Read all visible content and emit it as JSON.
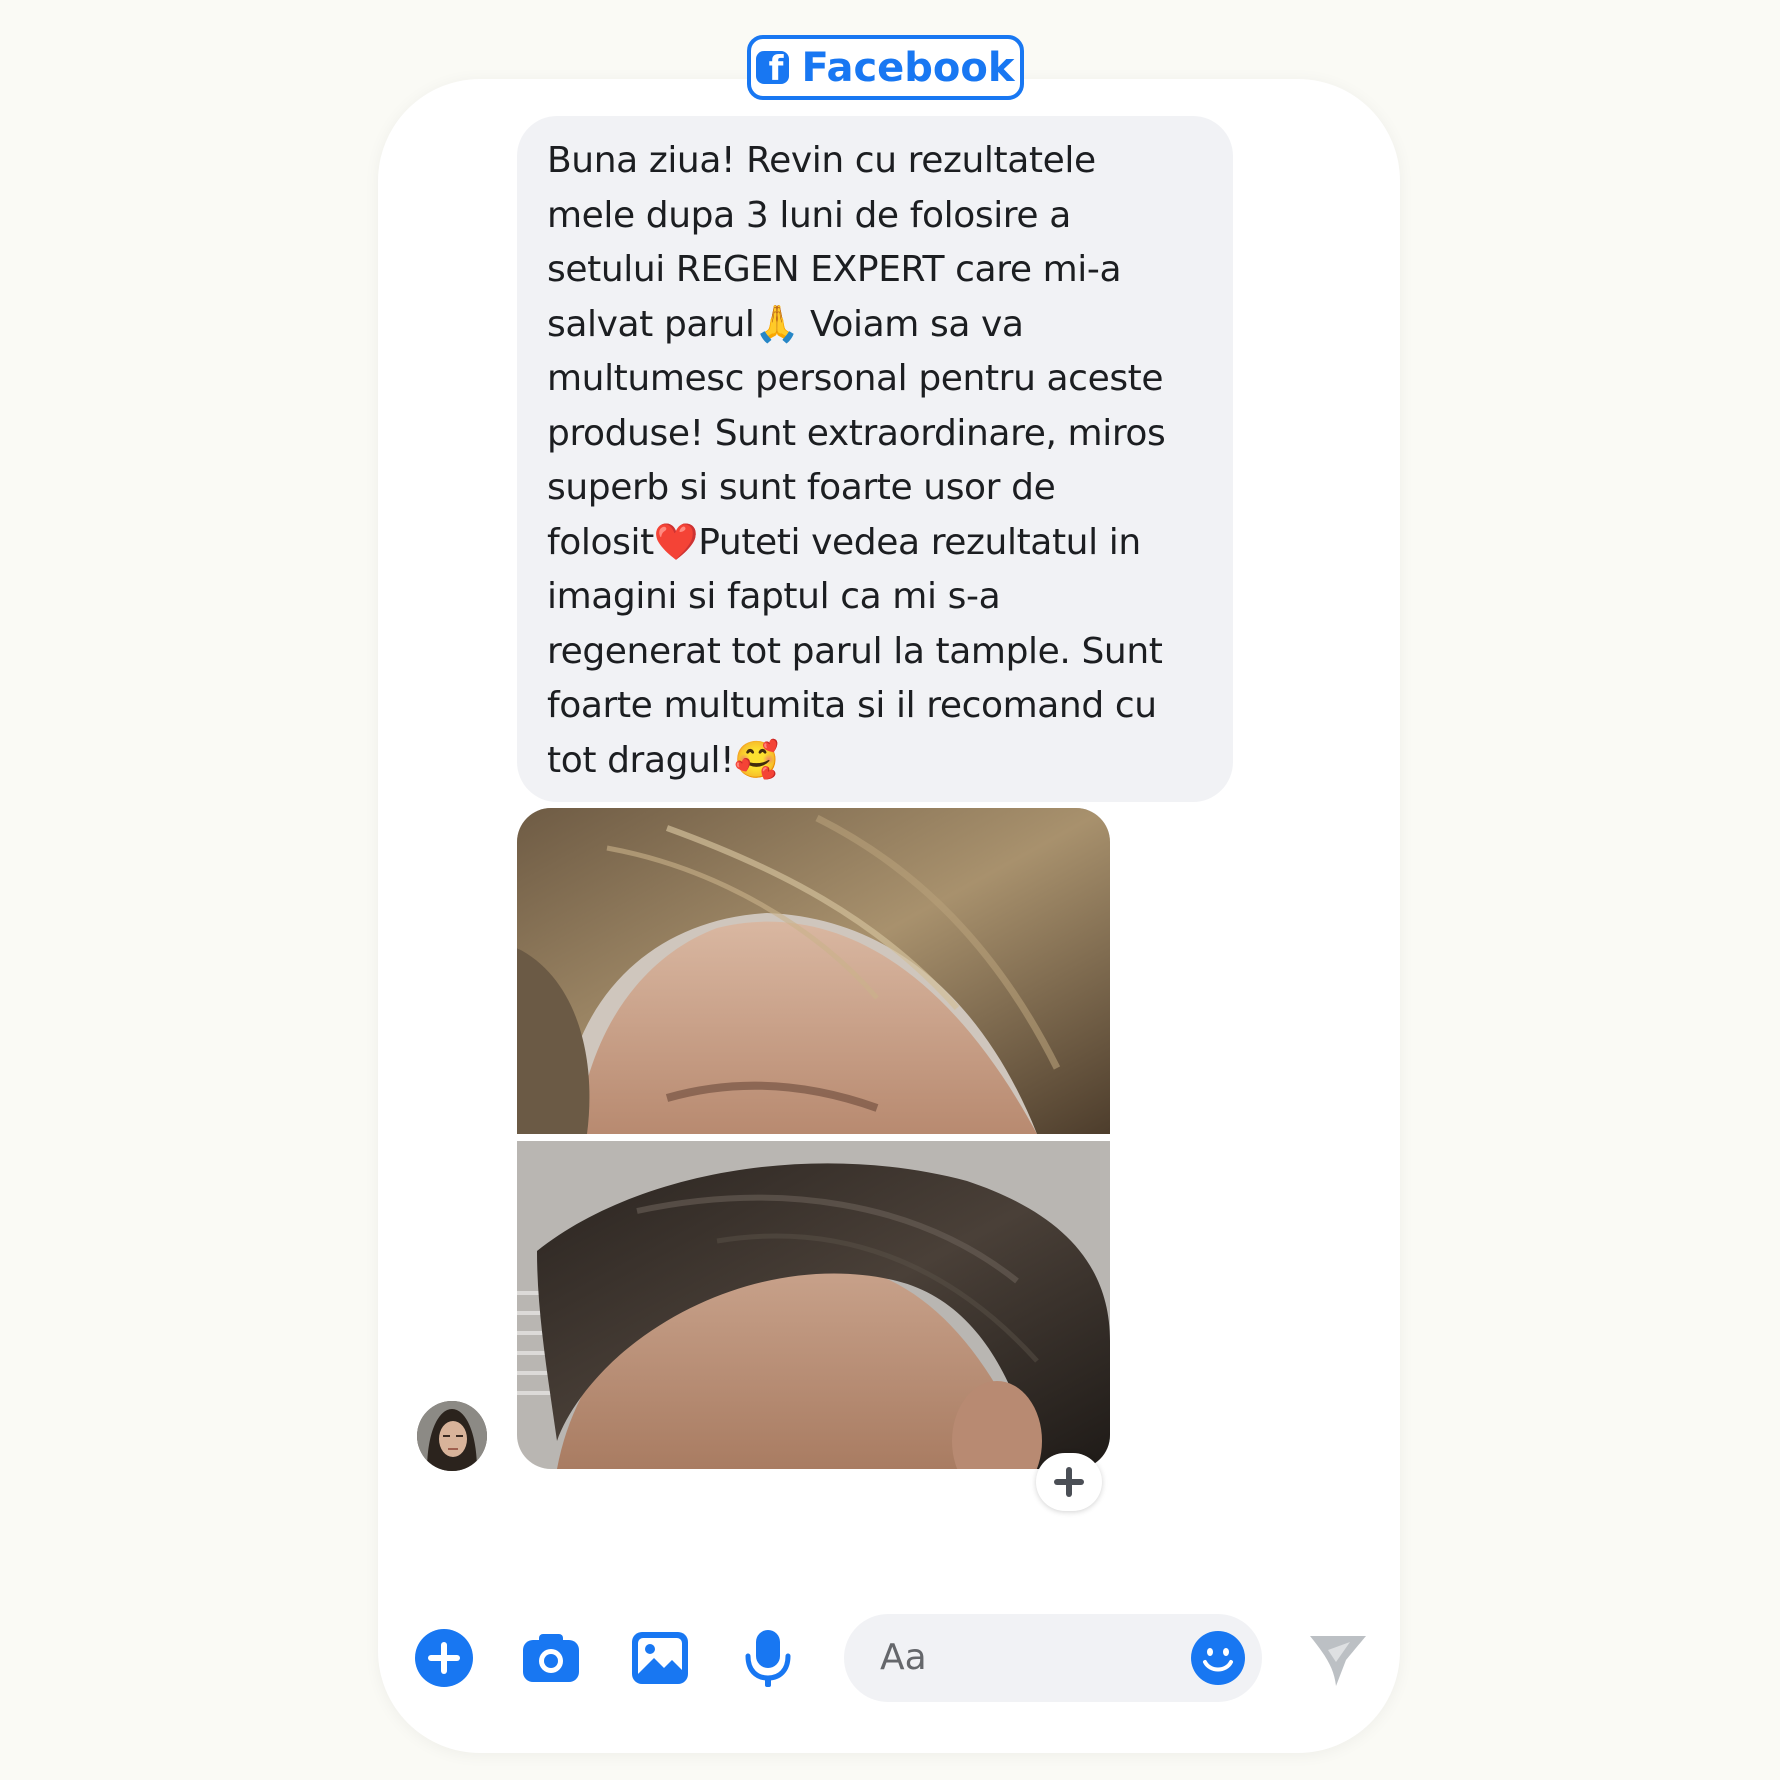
{
  "header": {
    "badge_label": "Facebook",
    "badge_icon": "facebook-logo-icon",
    "badge_color": "#1877f2"
  },
  "conversation": {
    "message_text": "Buna ziua! Revin cu rezultatele\nmele dupa 3 luni de folosire a\nsetului REGEN EXPERT care mi-a\nsalvat parul🙏 Voiam sa va\nmultumesc personal pentru aceste\nproduse! Sunt extraordinare, miros\nsuperb si sunt foarte usor de\nfolosit❤️Puteti vedea rezultatul in\nimagini si faptul ca mi s-a\nregenerat tot parul la tample. Sunt\nfoarte multumita si il recomand cu\ntot dragul!🥰",
    "bubble_color": "#f1f2f5",
    "photos": [
      {
        "description_icon": "before-hairline-photo"
      },
      {
        "description_icon": "after-hairline-photo"
      }
    ],
    "reaction_icon": "plus-icon",
    "sender_avatar": "avatar-photo"
  },
  "composer": {
    "icons": [
      "plus-circle-icon",
      "camera-icon",
      "image-icon",
      "microphone-icon"
    ],
    "placeholder": "Aa",
    "emoji_icon": "smiley-icon",
    "send_icon": "send-icon",
    "accent_color": "#1877f2"
  }
}
